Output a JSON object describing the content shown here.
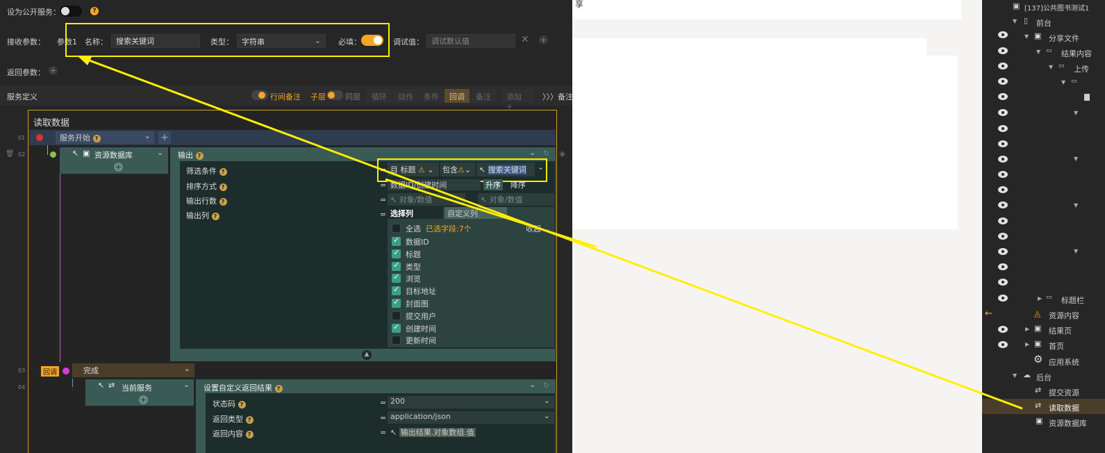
{
  "top": {
    "public_service_label": "设为公开服务：",
    "receive_params_label": "接收参数：",
    "param_index": "参数1",
    "name_label": "名称：",
    "name_value": "搜索关键词",
    "type_label": "类型：",
    "type_value": "字符串",
    "required_label": "必填：",
    "debug_label": "调试值：",
    "debug_placeholder": "调试默认值",
    "return_params_label": "返回参数："
  },
  "toolbar": {
    "service_def_label": "服务定义",
    "row_note": "行间备注",
    "sub_layer": "子层",
    "same_layer": "同层",
    "loop": "循环",
    "action": "动作",
    "condition": "条件",
    "callback": "回调",
    "note": "备注",
    "add": "添加",
    "note2": "备注"
  },
  "flow": {
    "title": "读取数据",
    "line_numbers": [
      "01",
      "02",
      "03",
      "04"
    ],
    "service_start": "服务开始",
    "resource_db": "资源数据库",
    "output_label": "输出",
    "filter_label": "筛选条件",
    "filter_field": "标题",
    "filter_op": "包含",
    "filter_value": "搜索关键词",
    "sort_label": "排序方式",
    "sort_field": "数据ID/创建时间",
    "sort_asc": "升序",
    "sort_desc": "降序",
    "rows_label": "输出行数",
    "rows_placeholder_1": "对象/数值",
    "rows_placeholder_2": "对象/数值",
    "columns_label": "输出列",
    "tab_select": "选择列",
    "tab_custom": "自定义列",
    "select_all": "全选",
    "selected_count": "已选字段:7个",
    "collapse": "收起",
    "callback_badge": "回调",
    "complete": "完成",
    "current_service": "当前服务",
    "set_return": "设置自定义返回结果",
    "status_code_label": "状态码",
    "status_code_value": "200",
    "return_type_label": "返回类型",
    "return_type_value": "application/json",
    "return_content_label": "返回内容",
    "return_content_value": "输出结果.对象数组.值",
    "eq": "="
  },
  "columns": [
    {
      "label": "数据ID",
      "checked": true
    },
    {
      "label": "标题",
      "checked": true
    },
    {
      "label": "类型",
      "checked": true
    },
    {
      "label": "浏览",
      "checked": true
    },
    {
      "label": "目标地址",
      "checked": true
    },
    {
      "label": "封面图",
      "checked": true
    },
    {
      "label": "提交用户",
      "checked": false
    },
    {
      "label": "创建时间",
      "checked": true
    },
    {
      "label": "更新时间",
      "checked": false
    }
  ],
  "preview": {
    "text": "享"
  },
  "tree": {
    "root": "[137]公共图书测试1",
    "frontend": "前台",
    "share_file": "分享文件",
    "result_content": "结果内容",
    "upload": "上传",
    "title_bar": "标题栏",
    "resource_content": "资源内容",
    "result_page": "结果页",
    "home_page": "首页",
    "app_system": "应用系统",
    "backend": "后台",
    "submit_resource": "提交资源",
    "read_data": "读取数据",
    "resource_db": "资源数据库"
  },
  "colors": {
    "accent": "#f5a623",
    "highlight": "#ffff00",
    "panel": "#3a5a55"
  }
}
